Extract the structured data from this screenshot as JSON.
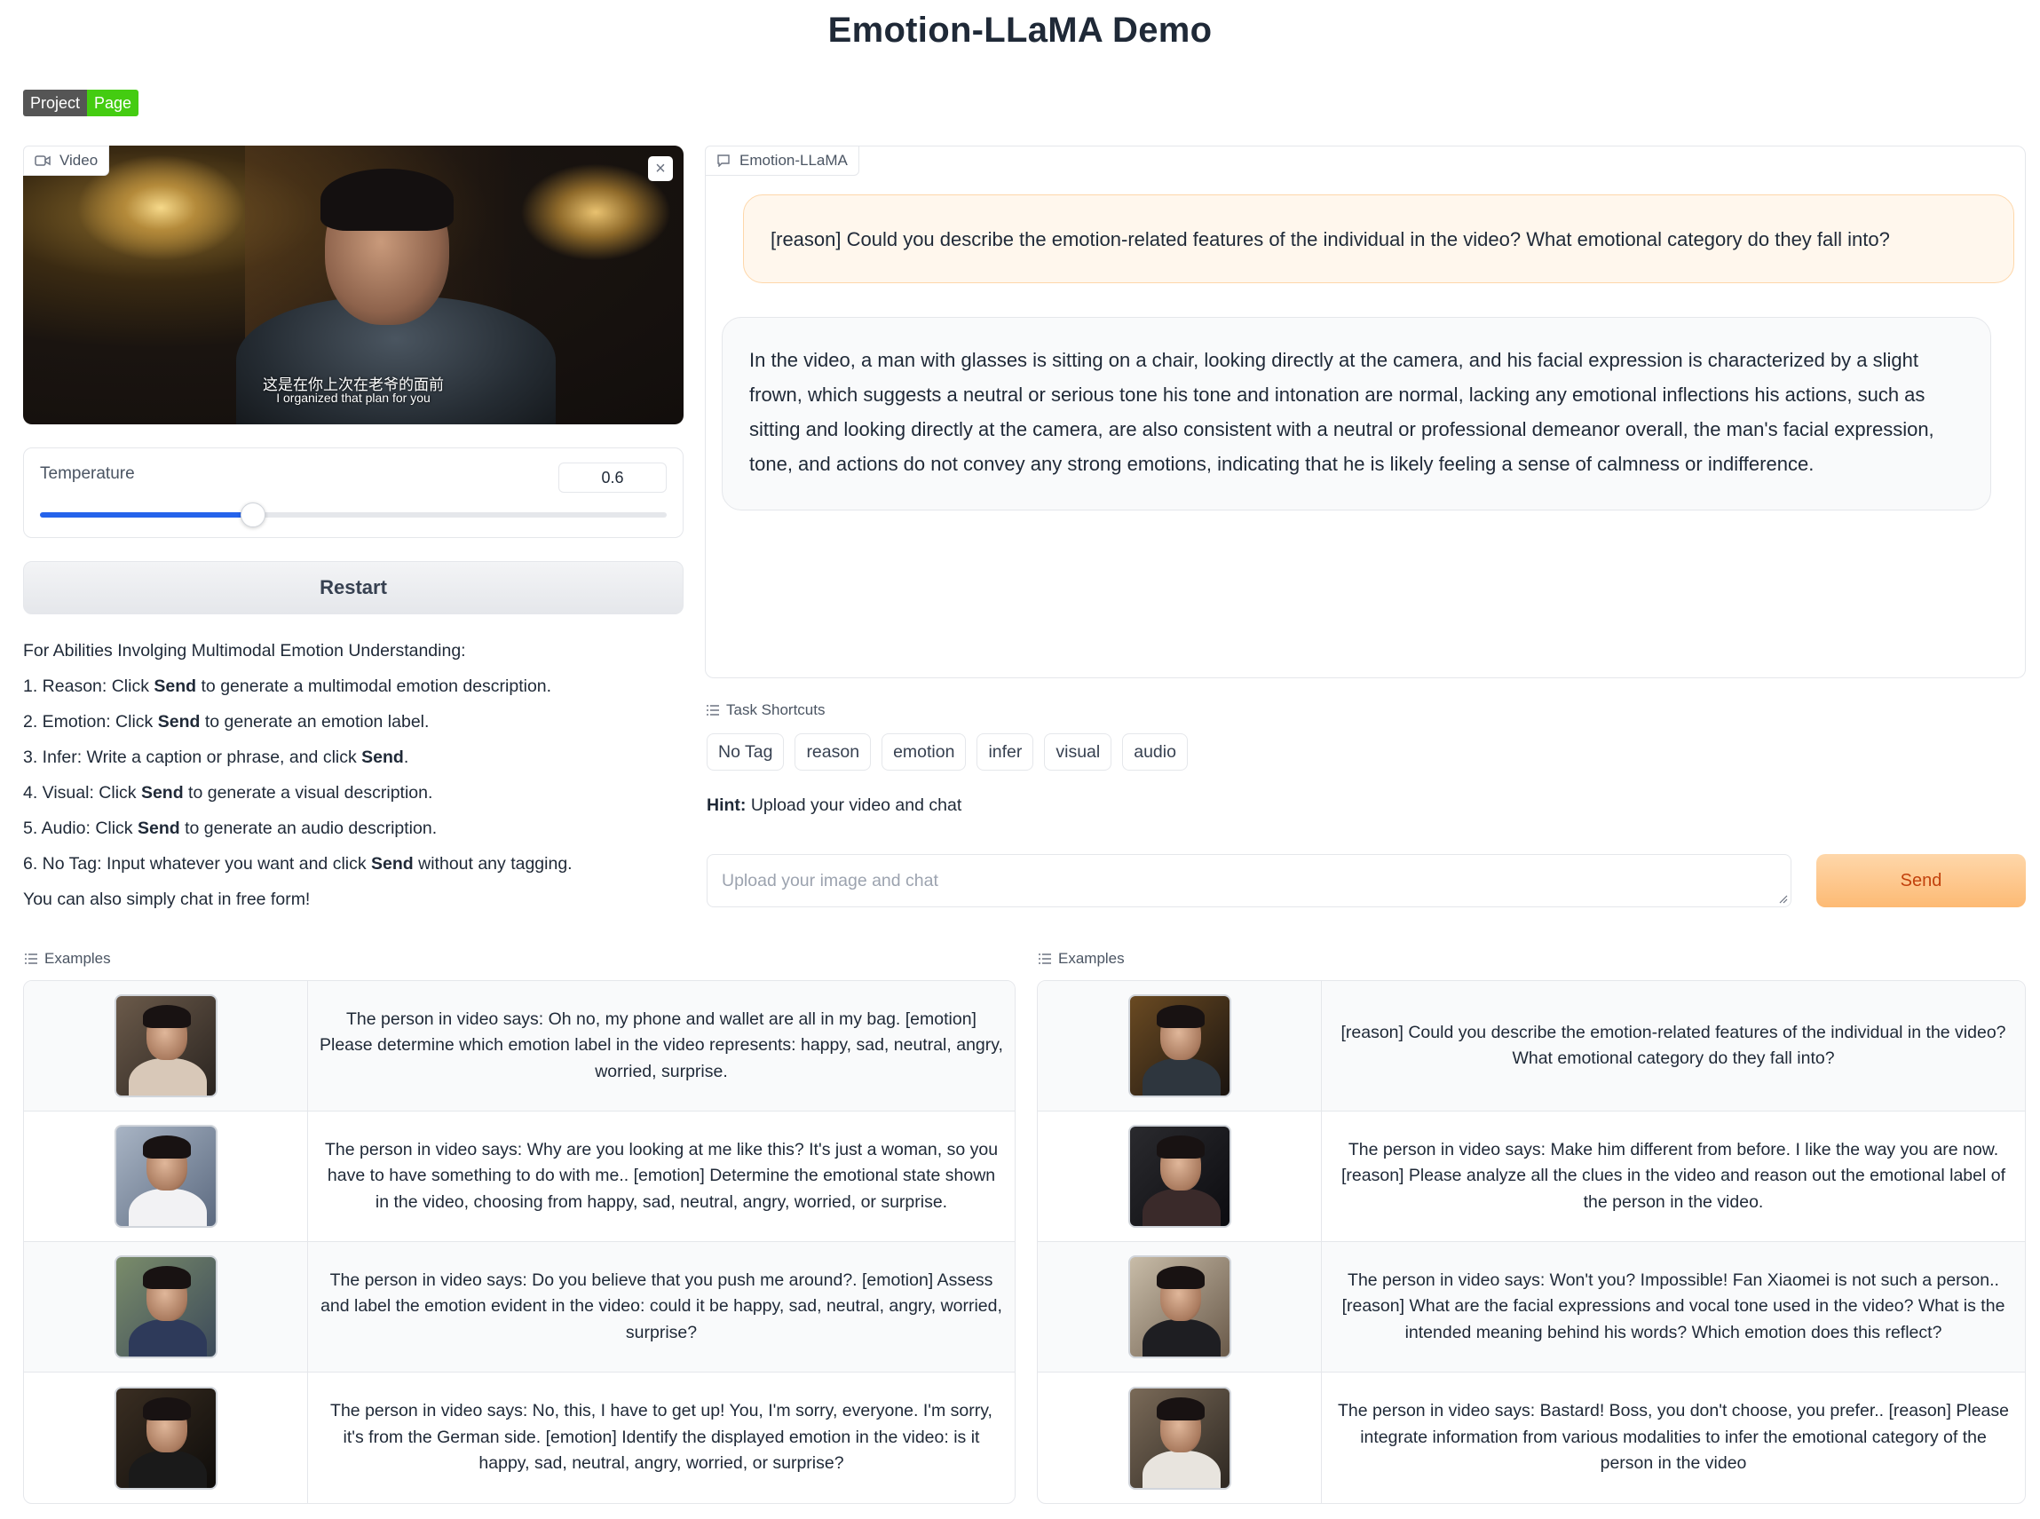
{
  "header": {
    "title": "Emotion-LLaMA Demo"
  },
  "badge": {
    "left": "Project",
    "right": "Page"
  },
  "video_panel": {
    "label": "Video",
    "subtitle_zh": "这是在你上次在老爷的面前",
    "subtitle_en": "I organized that plan for you",
    "close_glyph": "×"
  },
  "temperature": {
    "label": "Temperature",
    "value": "0.6",
    "fraction": 0.34
  },
  "restart_label": "Restart",
  "instructions": {
    "intro": "For Abilities Involging Multimodal Emotion Understanding:",
    "items": [
      {
        "pre": "1. Reason: Click ",
        "bold": "Send",
        "post": " to generate a multimodal emotion description."
      },
      {
        "pre": "2. Emotion: Click ",
        "bold": "Send",
        "post": " to generate an emotion label."
      },
      {
        "pre": "3. Infer: Write a caption or phrase, and click ",
        "bold": "Send",
        "post": "."
      },
      {
        "pre": "4. Visual: Click ",
        "bold": "Send",
        "post": " to generate a visual description."
      },
      {
        "pre": "5. Audio: Click ",
        "bold": "Send",
        "post": " to generate an audio description."
      },
      {
        "pre": "6. No Tag: Input whatever you want and click ",
        "bold": "Send",
        "post": " without any tagging."
      }
    ],
    "outro": "You can also simply chat in free form!"
  },
  "chatbot": {
    "label": "Emotion-LLaMA",
    "user_message": "[reason] Could you describe the emotion-related features of the individual in the video? What emotional category do they fall into?",
    "bot_message": "In the video, a man with glasses is sitting on a chair, looking directly at the camera, and his facial expression is characterized by a slight frown, which suggests a neutral or serious tone his tone and intonation are normal, lacking any emotional inflections his actions, such as sitting and looking directly at the camera, are also consistent with a neutral or professional demeanor overall, the man's facial expression, tone, and actions do not convey any strong emotions, indicating that he is likely feeling a sense of calmness or indifference."
  },
  "task_shortcuts": {
    "label": "Task Shortcuts",
    "items": [
      "No Tag",
      "reason",
      "emotion",
      "infer",
      "visual",
      "audio"
    ]
  },
  "hint": {
    "bold": "Hint:",
    "text": " Upload your video and chat"
  },
  "chat_input": {
    "placeholder": "Upload your image and chat",
    "value": ""
  },
  "send_label": "Send",
  "examples_left": {
    "label": "Examples",
    "rows": [
      "The person in video says: Oh no, my phone and wallet are all in my bag. [emotion] Please determine which emotion label in the video represents: happy, sad, neutral, angry, worried, surprise.",
      "The person in video says: Why are you looking at me like this? It's just a woman, so you have to have something to do with me.. [emotion] Determine the emotional state shown in the video, choosing from happy, sad, neutral, angry, worried, or surprise.",
      "The person in video says: Do you believe that you push me around?. [emotion] Assess and label the emotion evident in the video: could it be happy, sad, neutral, angry, worried, surprise?",
      "The person in video says: No, this, I have to get up! You, I'm sorry, everyone. I'm sorry, it's from the German side. [emotion] Identify the displayed emotion in the video: is it happy, sad, neutral, angry, worried, or surprise?"
    ]
  },
  "examples_right": {
    "label": "Examples",
    "rows": [
      "[reason] Could you describe the emotion-related features of the individual in the video? What emotional category do they fall into?",
      "The person in video says: Make him different from before. I like the way you are now. [reason] Please analyze all the clues in the video and reason out the emotional label of the person in the video.",
      "The person in video says: Won't you? Impossible! Fan Xiaomei is not such a person.. [reason] What are the facial expressions and vocal tone used in the video? What is the intended meaning behind his words? Which emotion does this reflect?",
      "The person in video says: Bastard! Boss, you don't choose, you prefer.. [reason] Please integrate information from various modalities to infer the emotional category of the person in the video"
    ]
  },
  "colors": {
    "accent_blue": "#2563eb",
    "send_orange": "#fdba74",
    "user_bubble": "#fff7ed",
    "badge_green": "#44cc11"
  },
  "icons": {
    "video_label": "video-camera-icon",
    "chat_label": "chat-bubble-icon",
    "list_label": "list-icon",
    "close": "close-icon",
    "resize": "resize-handle-icon"
  }
}
